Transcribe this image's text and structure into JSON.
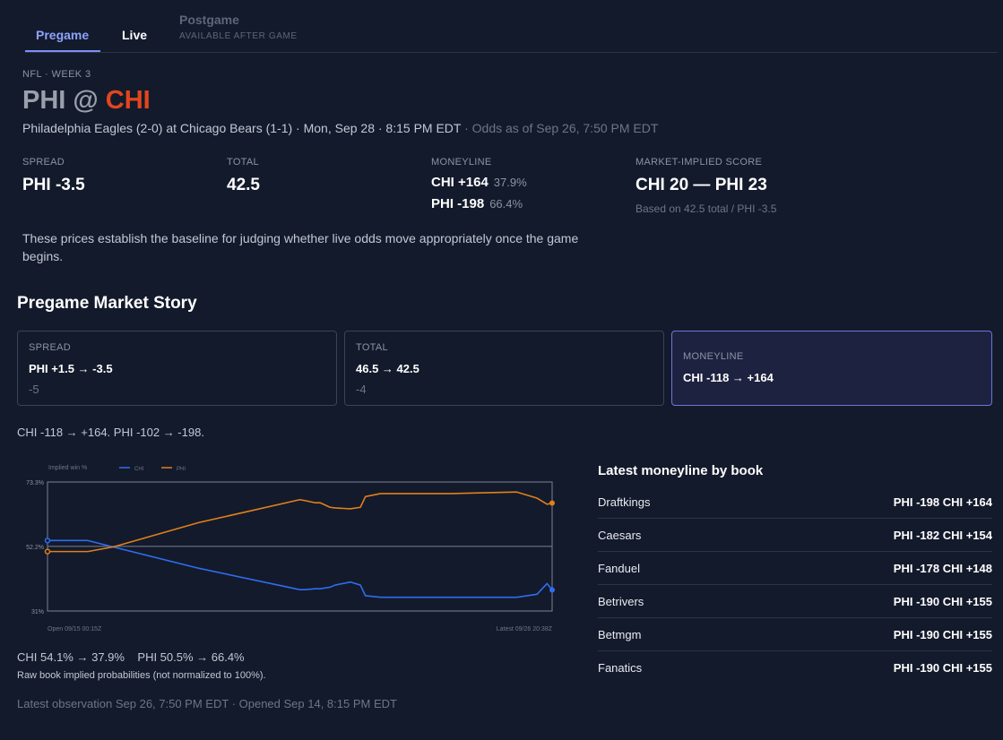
{
  "tabs": {
    "pregame": "Pregame",
    "live": "Live",
    "postgame": "Postgame",
    "postgame_sub": "AVAILABLE AFTER GAME"
  },
  "header": {
    "eyebrow": "NFL · WEEK 3",
    "away": "PHI",
    "at": "@",
    "home": "CHI",
    "subline": "Philadelphia Eagles (2-0) at Chicago Bears (1-1) · Mon, Sep 28 · 8:15 PM EDT",
    "odds_as_of": " · Odds as of Sep 26, 7:50 PM EDT"
  },
  "stats": {
    "spread_label": "SPREAD",
    "spread_value": "PHI -3.5",
    "total_label": "TOTAL",
    "total_value": "42.5",
    "moneyline_label": "MONEYLINE",
    "ml_chi": "CHI +164",
    "ml_chi_pct": "37.9%",
    "ml_phi": "PHI -198",
    "ml_phi_pct": "66.4%",
    "implied_label": "MARKET-IMPLIED SCORE",
    "implied_value": "CHI 20 — PHI 23",
    "implied_note": "Based on 42.5 total / PHI -3.5"
  },
  "description": "These prices establish the baseline for judging whether live odds move appropriately once the game begins.",
  "story": {
    "title": "Pregame Market Story",
    "cards": [
      {
        "label": "SPREAD",
        "value": "PHI +1.5 → -3.5",
        "delta": "-5"
      },
      {
        "label": "TOTAL",
        "value": "46.5 → 42.5",
        "delta": "-4"
      },
      {
        "label": "MONEYLINE",
        "value": "CHI -118 → +164",
        "delta": ""
      }
    ],
    "summary": "CHI -118 → +164. PHI -102 → -198."
  },
  "chart_caption": {
    "main": "CHI 54.1% → 37.9%    PHI 50.5% → 66.4%",
    "note": "Raw book implied probabilities (not normalized to 100%)."
  },
  "footer": "Latest observation Sep 26, 7:50 PM EDT · Opened Sep 14, 8:15 PM EDT",
  "books": {
    "title": "Latest moneyline by book",
    "rows": [
      {
        "name": "Draftkings",
        "odds": "PHI -198 CHI +164"
      },
      {
        "name": "Caesars",
        "odds": "PHI -182 CHI +154"
      },
      {
        "name": "Fanduel",
        "odds": "PHI -178 CHI +148"
      },
      {
        "name": "Betrivers",
        "odds": "PHI -190 CHI +155"
      },
      {
        "name": "Betmgm",
        "odds": "PHI -190 CHI +155"
      },
      {
        "name": "Fanatics",
        "odds": "PHI -190 CHI +155"
      }
    ]
  },
  "colors": {
    "chi": "#2f6df0",
    "phi": "#e0801c",
    "accent": "#8ea2ff",
    "home_team": "#e2461d"
  },
  "chart_data": {
    "type": "line",
    "ylabel": "Implied win %",
    "y_ticks": [
      "73.3%",
      "52.2%",
      "31%"
    ],
    "ylim": [
      31,
      73.3
    ],
    "x_labels": [
      "Open 09/15 00:15Z",
      "Latest 09/26 20:38Z"
    ],
    "x": [
      0,
      0.08,
      0.13,
      0.3,
      0.5,
      0.51,
      0.53,
      0.54,
      0.56,
      0.57,
      0.6,
      0.62,
      0.63,
      0.66,
      0.68,
      0.8,
      0.93,
      0.97,
      0.99,
      1.0
    ],
    "legend_position": "top",
    "series": [
      {
        "name": "CHI",
        "values": [
          54.1,
          54.1,
          52.0,
          45.0,
          38.0,
          38.0,
          38.3,
          38.3,
          38.8,
          39.5,
          40.5,
          39.5,
          36.0,
          35.5,
          35.5,
          35.5,
          35.5,
          36.5,
          40.0,
          37.9
        ]
      },
      {
        "name": "PHI",
        "values": [
          50.5,
          50.5,
          52.0,
          60.0,
          67.5,
          67.2,
          66.5,
          66.5,
          65.0,
          64.8,
          64.5,
          65.0,
          68.5,
          69.5,
          69.5,
          69.5,
          70.0,
          68.0,
          66.0,
          66.4
        ]
      }
    ]
  }
}
